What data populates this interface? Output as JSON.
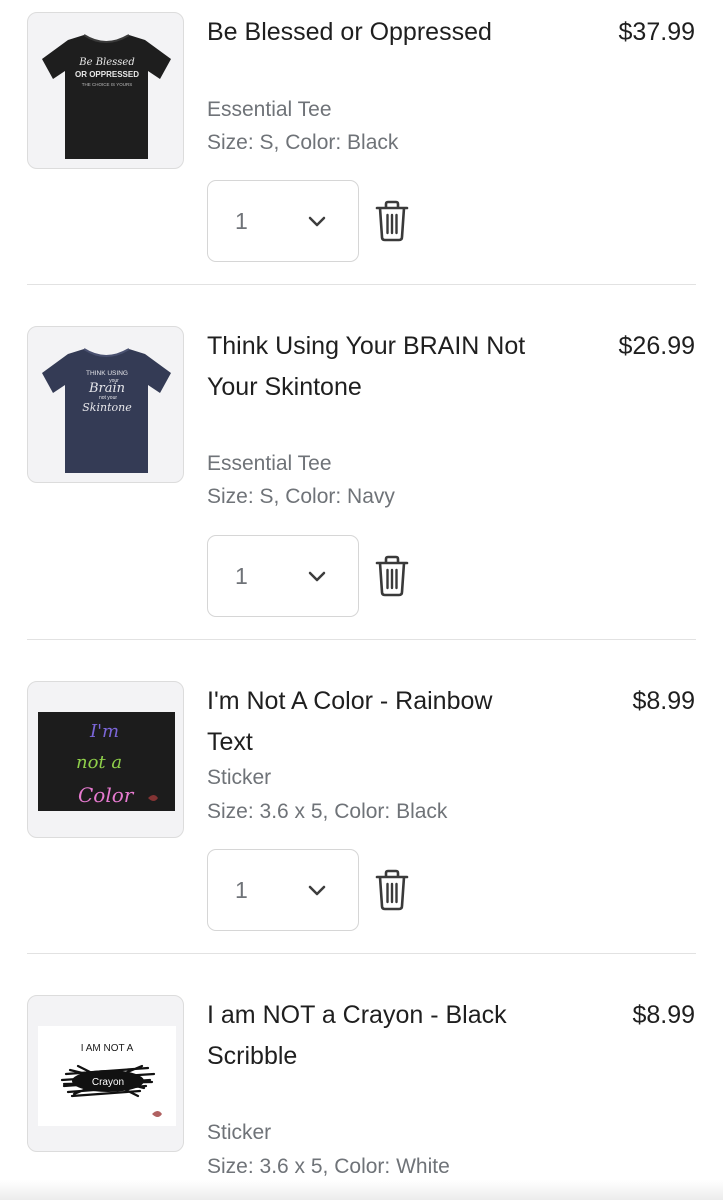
{
  "cart": {
    "items": [
      {
        "title": "Be Blessed or Oppressed",
        "product_type": "Essential Tee",
        "variant": "Size: S, Color: Black",
        "price": "$37.99",
        "quantity": "1",
        "image": {
          "line1": "Be Blessed",
          "line2": "OR OPPRESSED",
          "line3": "THE CHOICE IS YOURS",
          "shirt_color": "#1e1e1e"
        }
      },
      {
        "title": "Think Using Your BRAIN Not Your Skintone",
        "product_type": "Essential Tee",
        "variant": "Size: S, Color: Navy",
        "price": "$26.99",
        "quantity": "1",
        "image": {
          "line1": "THINK USING",
          "line2": "your",
          "line3": "Brain",
          "line4": "not your",
          "line5": "Skintone",
          "shirt_color": "#343b55"
        }
      },
      {
        "title": "I'm Not A Color - Rainbow Text",
        "product_type": "Sticker",
        "variant": "Size: 3.6 x 5, Color: Black",
        "price": "$8.99",
        "quantity": "1",
        "image": {
          "line1": "I'm",
          "line2": "not a",
          "line3": "Color",
          "background": "#1c1c1c"
        }
      },
      {
        "title": "I am NOT a Crayon - Black Scribble",
        "product_type": "Sticker",
        "variant": "Size: 3.6 x 5, Color: White",
        "price": "$8.99",
        "image": {
          "line1": "I AM NOT A",
          "line2": "Crayon",
          "background": "#ffffff"
        }
      }
    ]
  },
  "colors": {
    "text_primary": "#1f1f1f",
    "text_secondary": "#6f7378",
    "border": "#d6d6d6",
    "divider": "#e2e2e2",
    "thumb_bg": "#f3f3f5"
  },
  "icons": {
    "quantity_dropdown": "chevron-down-icon",
    "remove_item": "trash-icon"
  }
}
